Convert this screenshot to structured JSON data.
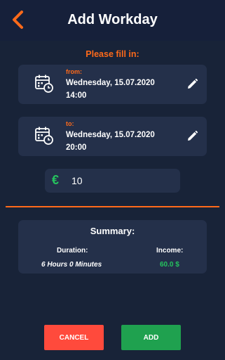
{
  "header": {
    "title": "Add Workday"
  },
  "form": {
    "prompt": "Please fill in:",
    "from": {
      "label": "from:",
      "date": "Wednesday, 15.07.2020",
      "time": "14:00"
    },
    "to": {
      "label": "to:",
      "date": "Wednesday, 15.07.2020",
      "time": "20:00"
    },
    "currency_symbol": "€",
    "amount": "10"
  },
  "summary": {
    "title": "Summary:",
    "duration_label": "Duration:",
    "duration_value": "6 Hours 0 Minutes",
    "income_label": "Income:",
    "income_value": "60.0 $"
  },
  "actions": {
    "cancel": "CANCEL",
    "add": "ADD"
  },
  "colors": {
    "background": "#182338",
    "card": "#24304a",
    "accent": "#ff6a1a",
    "positive": "#25c35e",
    "cancel": "#ff4a3c",
    "add": "#1fa14f"
  },
  "icons": {
    "back": "chevron-left-icon",
    "calendar": "calendar-clock-icon",
    "edit": "pencil-icon",
    "currency": "euro-icon"
  }
}
